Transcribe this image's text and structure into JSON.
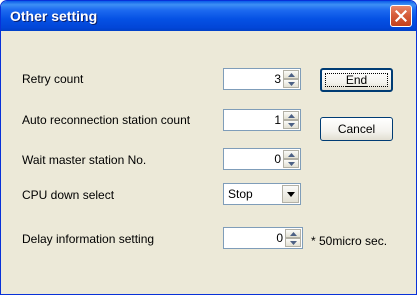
{
  "window": {
    "title": "Other setting"
  },
  "fields": {
    "retry_count": {
      "label": "Retry count",
      "value": "3"
    },
    "auto_reconnection": {
      "label": "Auto reconnection station count",
      "value": "1"
    },
    "wait_master": {
      "label": "Wait master station No.",
      "value": "0"
    },
    "cpu_down": {
      "label": "CPU down select",
      "value": "Stop"
    },
    "delay_info": {
      "label": "Delay information setting",
      "value": "0",
      "unit": "* 50micro sec."
    }
  },
  "buttons": {
    "end": {
      "label": "End"
    },
    "cancel": {
      "label": "Cancel"
    }
  },
  "icons": {
    "close": "close-icon",
    "spin_up": "arrow-up-icon",
    "spin_down": "arrow-down-icon",
    "dropdown": "chevron-down-icon"
  },
  "colors": {
    "titlebar": "#0551e4",
    "close_button": "#d65d3a",
    "dialog_background": "#ece9d8",
    "field_border": "#7f9db9"
  }
}
